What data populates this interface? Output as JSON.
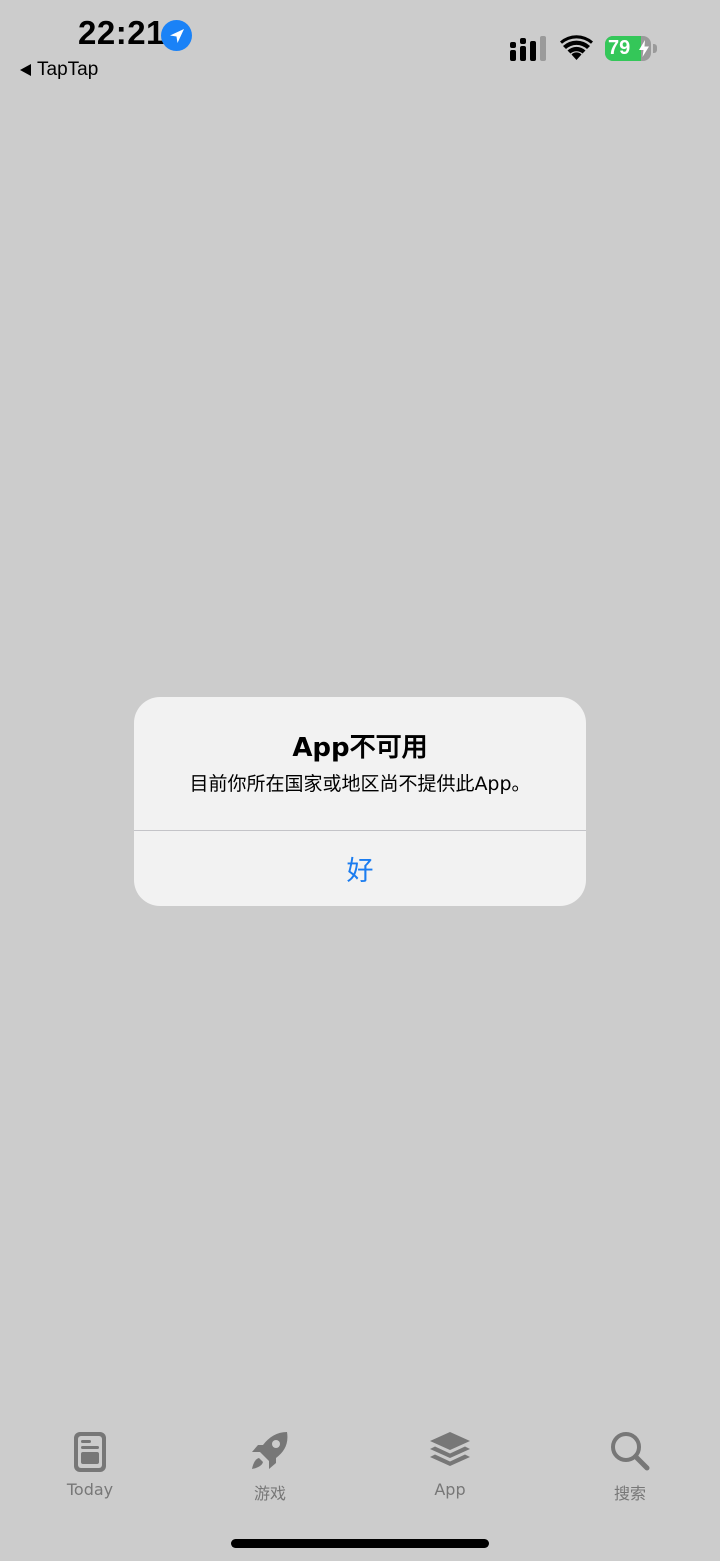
{
  "status_bar": {
    "time": "22:21",
    "back_app": "TapTap",
    "battery_percent": "79",
    "battery_level": 0.79,
    "battery_color": "#34c759",
    "location_icon": "location-arrow-icon",
    "signal_icon": "cellular-signal-icon",
    "wifi_icon": "wifi-icon"
  },
  "alert": {
    "title": "App不可用",
    "message": "目前你所在国家或地区尚不提供此App。",
    "ok_button": "好",
    "button_color": "#1a7cf0"
  },
  "tab_bar": {
    "tabs": [
      {
        "label": "Today",
        "icon": "today-icon"
      },
      {
        "label": "游戏",
        "icon": "rocket-icon"
      },
      {
        "label": "App",
        "icon": "stack-icon"
      },
      {
        "label": "搜索",
        "icon": "search-icon"
      }
    ]
  }
}
